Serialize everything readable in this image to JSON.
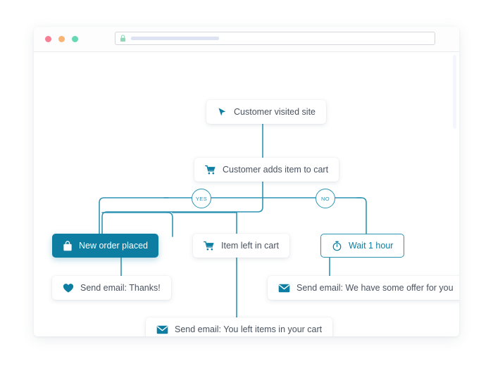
{
  "window": {
    "traffic_lights": [
      {
        "name": "close",
        "color": "#f77f94"
      },
      {
        "name": "minimize",
        "color": "#f9b475"
      },
      {
        "name": "maximize",
        "color": "#66d9b4"
      }
    ],
    "url_bar": {
      "value": "",
      "placeholder": "",
      "lock_icon": "lock-icon"
    }
  },
  "theme": {
    "accent": "#0d7ea2",
    "accent_light": "#2e94b4",
    "node_text": "#4a5360",
    "canvas_bg": "#ffffff"
  },
  "flow": {
    "nodes": [
      {
        "id": "visited",
        "label": "Customer visited site",
        "icon": "cursor-icon",
        "style": "plain"
      },
      {
        "id": "adds",
        "label": "Customer adds item to cart",
        "icon": "cart-icon",
        "style": "plain"
      },
      {
        "id": "new_order",
        "label": "New order placed",
        "icon": "bag-icon",
        "style": "filled"
      },
      {
        "id": "item_left",
        "label": "Item left in cart",
        "icon": "cart-icon",
        "style": "plain"
      },
      {
        "id": "wait",
        "label": "Wait 1 hour",
        "icon": "stopwatch-icon",
        "style": "outlined"
      },
      {
        "id": "email_thanks",
        "label": "Send email: Thanks!",
        "icon": "heart-icon",
        "style": "plain"
      },
      {
        "id": "email_offer",
        "label": "Send email: We have some offer for you",
        "icon": "envelope-icon",
        "style": "plain"
      },
      {
        "id": "email_left",
        "label": "Send email: You left items in your cart",
        "icon": "envelope-icon",
        "style": "plain"
      }
    ],
    "decisions": [
      {
        "id": "yes",
        "label": "YES"
      },
      {
        "id": "no",
        "label": "NO"
      }
    ]
  }
}
